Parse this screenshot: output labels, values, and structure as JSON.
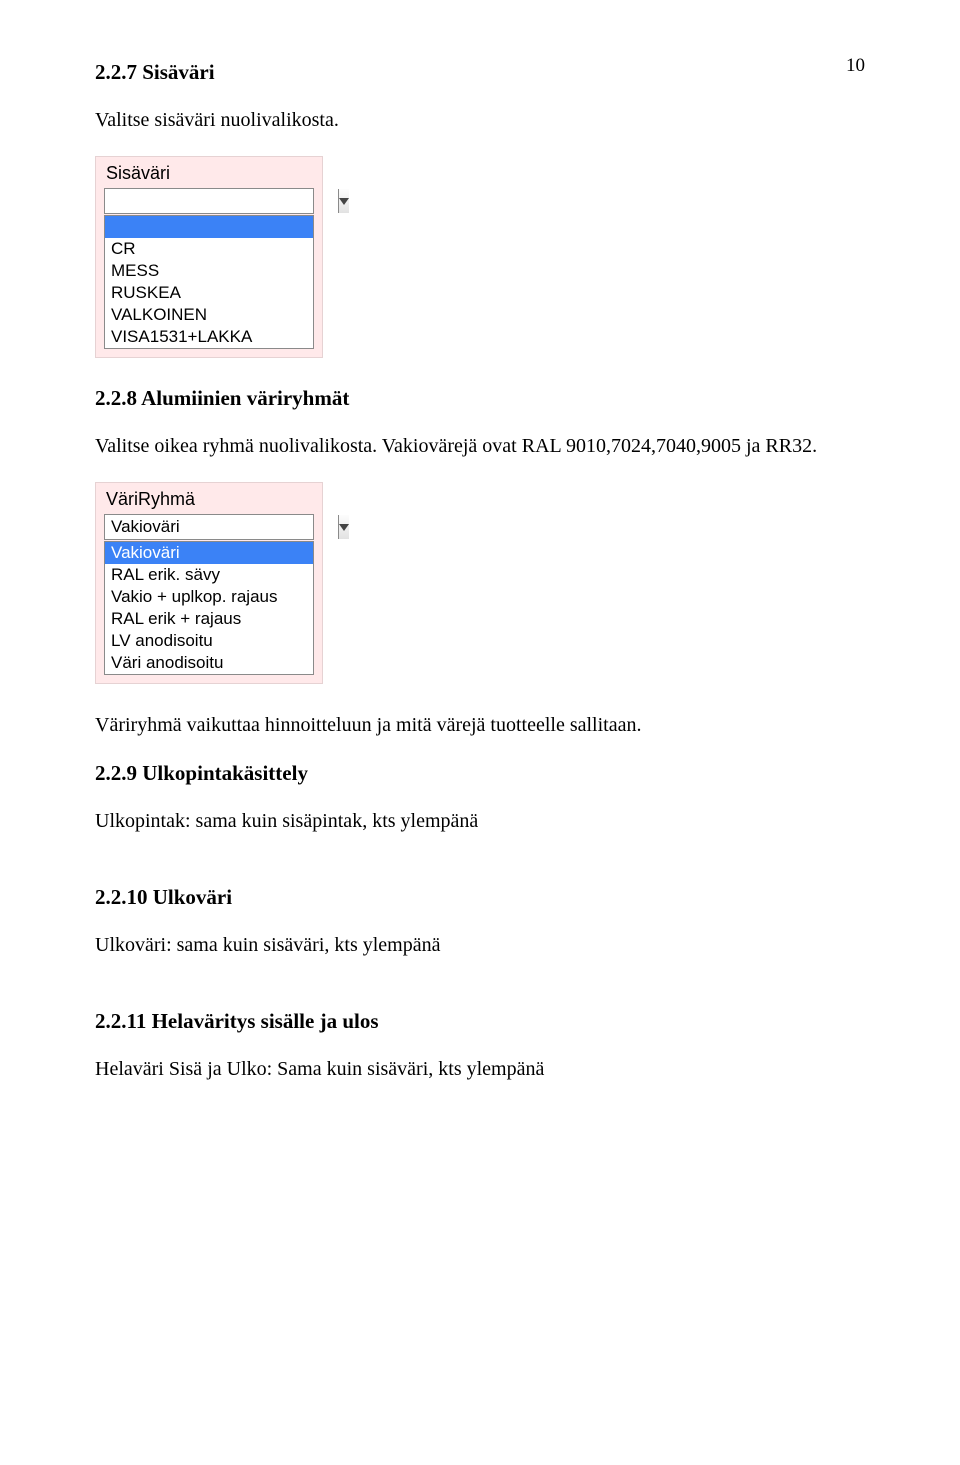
{
  "page_number": "10",
  "sections": {
    "s227": {
      "heading": "2.2.7 Sisäväri",
      "body": "Valitse sisäväri nuolivalikosta."
    },
    "s228": {
      "heading": "2.2.8 Alumiinien väriryhmät",
      "body1": "Valitse oikea ryhmä nuolivalikosta. Vakiovärejä ovat RAL 9010,7024,7040,9005 ja RR32.",
      "body2": "Väriryhmä vaikuttaa hinnoitteluun ja mitä värejä tuotteelle sallitaan."
    },
    "s229": {
      "heading": "2.2.9 Ulkopintakäsittely",
      "body": "Ulkopintak: sama kuin sisäpintak, kts ylempänä"
    },
    "s2210": {
      "heading": "2.2.10 Ulkoväri",
      "body": "Ulkoväri: sama kuin sisäväri, kts ylempänä"
    },
    "s2211": {
      "heading": "2.2.11 Helaväritys sisälle ja ulos",
      "body": "Helaväri Sisä ja Ulko: Sama kuin sisäväri, kts ylempänä"
    }
  },
  "dropdown1": {
    "label": "Sisäväri",
    "value": "",
    "options": [
      "",
      "CR",
      "MESS",
      "RUSKEA",
      "VALKOINEN",
      "VISA1531+LAKKA"
    ],
    "selected_index": 0
  },
  "dropdown2": {
    "label": "VäriRyhmä",
    "value": "Vakioväri",
    "options": [
      "Vakioväri",
      "RAL erik. sävy",
      "Vakio + uplkop. rajaus",
      "RAL erik + rajaus",
      "LV anodisoitu",
      "Väri anodisoitu"
    ],
    "selected_index": 0
  }
}
